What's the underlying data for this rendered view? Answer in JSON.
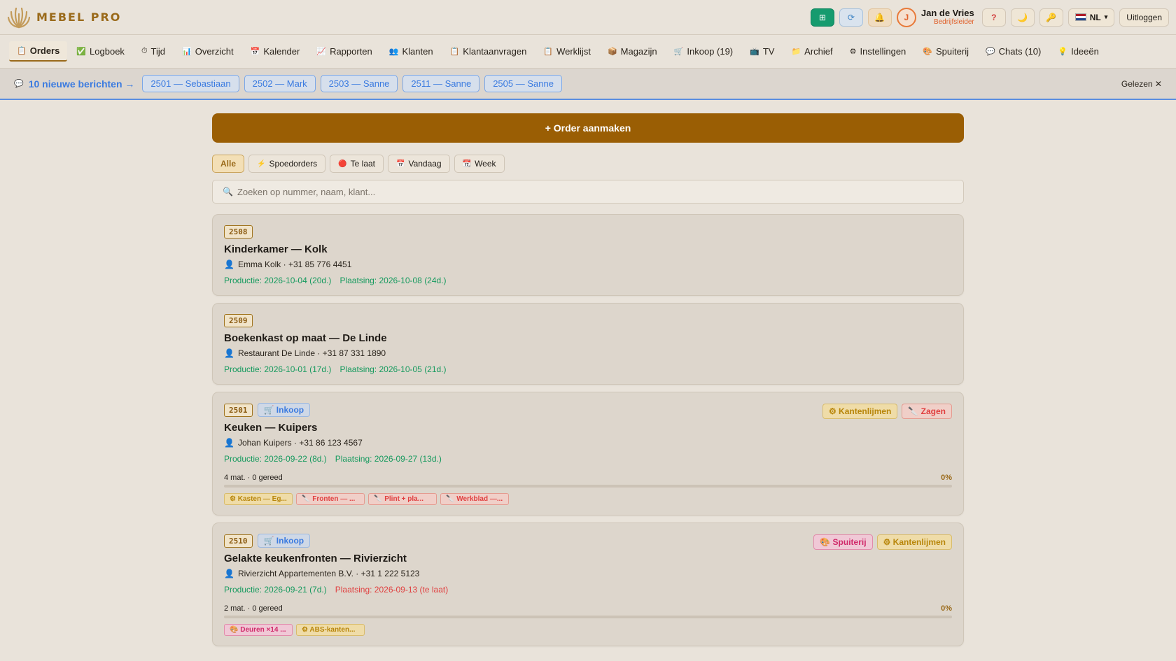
{
  "app": {
    "name": "MEBEL PRO"
  },
  "header": {
    "user_name": "Jan de Vries",
    "user_role": "Bedrijfsleider",
    "avatar_letter": "J",
    "lang": "NL",
    "logout": "Uitloggen",
    "help": "?"
  },
  "nav": [
    {
      "label": "Orders",
      "icon": "📋"
    },
    {
      "label": "Logboek",
      "icon": "✅"
    },
    {
      "label": "Tijd",
      "icon": "⏱"
    },
    {
      "label": "Overzicht",
      "icon": "📊"
    },
    {
      "label": "Kalender",
      "icon": "📅"
    },
    {
      "label": "Rapporten",
      "icon": "📈"
    },
    {
      "label": "Klanten",
      "icon": "👥"
    },
    {
      "label": "Klantaanvragen",
      "icon": "📋"
    },
    {
      "label": "Werklijst",
      "icon": "📋"
    },
    {
      "label": "Magazijn",
      "icon": "📦"
    },
    {
      "label": "Inkoop (19)",
      "icon": "🛒"
    },
    {
      "label": "TV",
      "icon": "📺"
    },
    {
      "label": "Archief",
      "icon": "📁"
    },
    {
      "label": "Instellingen",
      "icon": "⚙"
    },
    {
      "label": "Spuiterij",
      "icon": "🎨"
    },
    {
      "label": "Chats (10)",
      "icon": "💬"
    },
    {
      "label": "Ideeën",
      "icon": "💡"
    }
  ],
  "messages": {
    "count_label": "10 nieuwe berichten →",
    "chips": [
      "2501 — Sebastiaan",
      "2502 — Mark",
      "2503 — Sanne",
      "2511 — Sanne",
      "2505 — Sanne"
    ],
    "read_label": "Gelezen ✕"
  },
  "main": {
    "create_label": "+ Order aanmaken",
    "filters": [
      {
        "label": "Alle",
        "icon": ""
      },
      {
        "label": "Spoedorders",
        "icon": "⚡"
      },
      {
        "label": "Te laat",
        "icon": "🔴"
      },
      {
        "label": "Vandaag",
        "icon": "📅"
      },
      {
        "label": "Week",
        "icon": "📆"
      }
    ],
    "search_placeholder": "Zoeken op nummer, naam, klant..."
  },
  "orders": [
    {
      "number": "2508",
      "title": "Kinderkamer — Kolk",
      "contact": "Emma Kolk · +31 85 776 4451",
      "productie": "Productie: 2026-10-04 (20d.)",
      "plaatsing": "Plaatsing: 2026-10-08 (24d.)"
    },
    {
      "number": "2509",
      "title": "Boekenkast op maat — De Linde",
      "contact": "Restaurant De Linde · +31 87 331 1890",
      "productie": "Productie: 2026-10-01 (17d.)",
      "plaatsing": "Plaatsing: 2026-10-05 (21d.)"
    },
    {
      "number": "2501",
      "badge": "🛒 Inkoop",
      "tag1": "⚙ Kantenlijmen",
      "tag2": "🔪 Zagen",
      "title": "Keuken — Kuipers",
      "contact": "Johan Kuipers · +31 86 123 4567",
      "productie": "Productie: 2026-09-22 (8d.)",
      "plaatsing": "Plaatsing: 2026-09-27 (13d.)",
      "progress_label": "4 mat. · 0 gereed",
      "progress_pct": "0%",
      "progress_fraction": 0,
      "materials": [
        "⚙ Kasten — Eg...",
        "🔪 Fronten — ...",
        "🔪 Plint + pla...",
        "🔪 Werkblad —..."
      ]
    },
    {
      "number": "2510",
      "badge": "🛒 Inkoop",
      "tag1": "🎨 Spuiterij",
      "tag2": "⚙ Kantenlijmen",
      "title": "Gelakte keukenfronten — Rivierzicht",
      "contact": "Rivierzicht Appartementen B.V. · +31 1 222 5123",
      "productie": "Productie: 2026-09-21 (7d.)",
      "plaatsing": "Plaatsing: 2026-09-13 (te laat)",
      "progress_label": "2 mat. · 0 gereed",
      "progress_pct": "0%",
      "progress_fraction": 0,
      "materials": [
        "🎨 Deuren ×14 ...",
        "⚙ ABS-kanten..."
      ]
    }
  ]
}
